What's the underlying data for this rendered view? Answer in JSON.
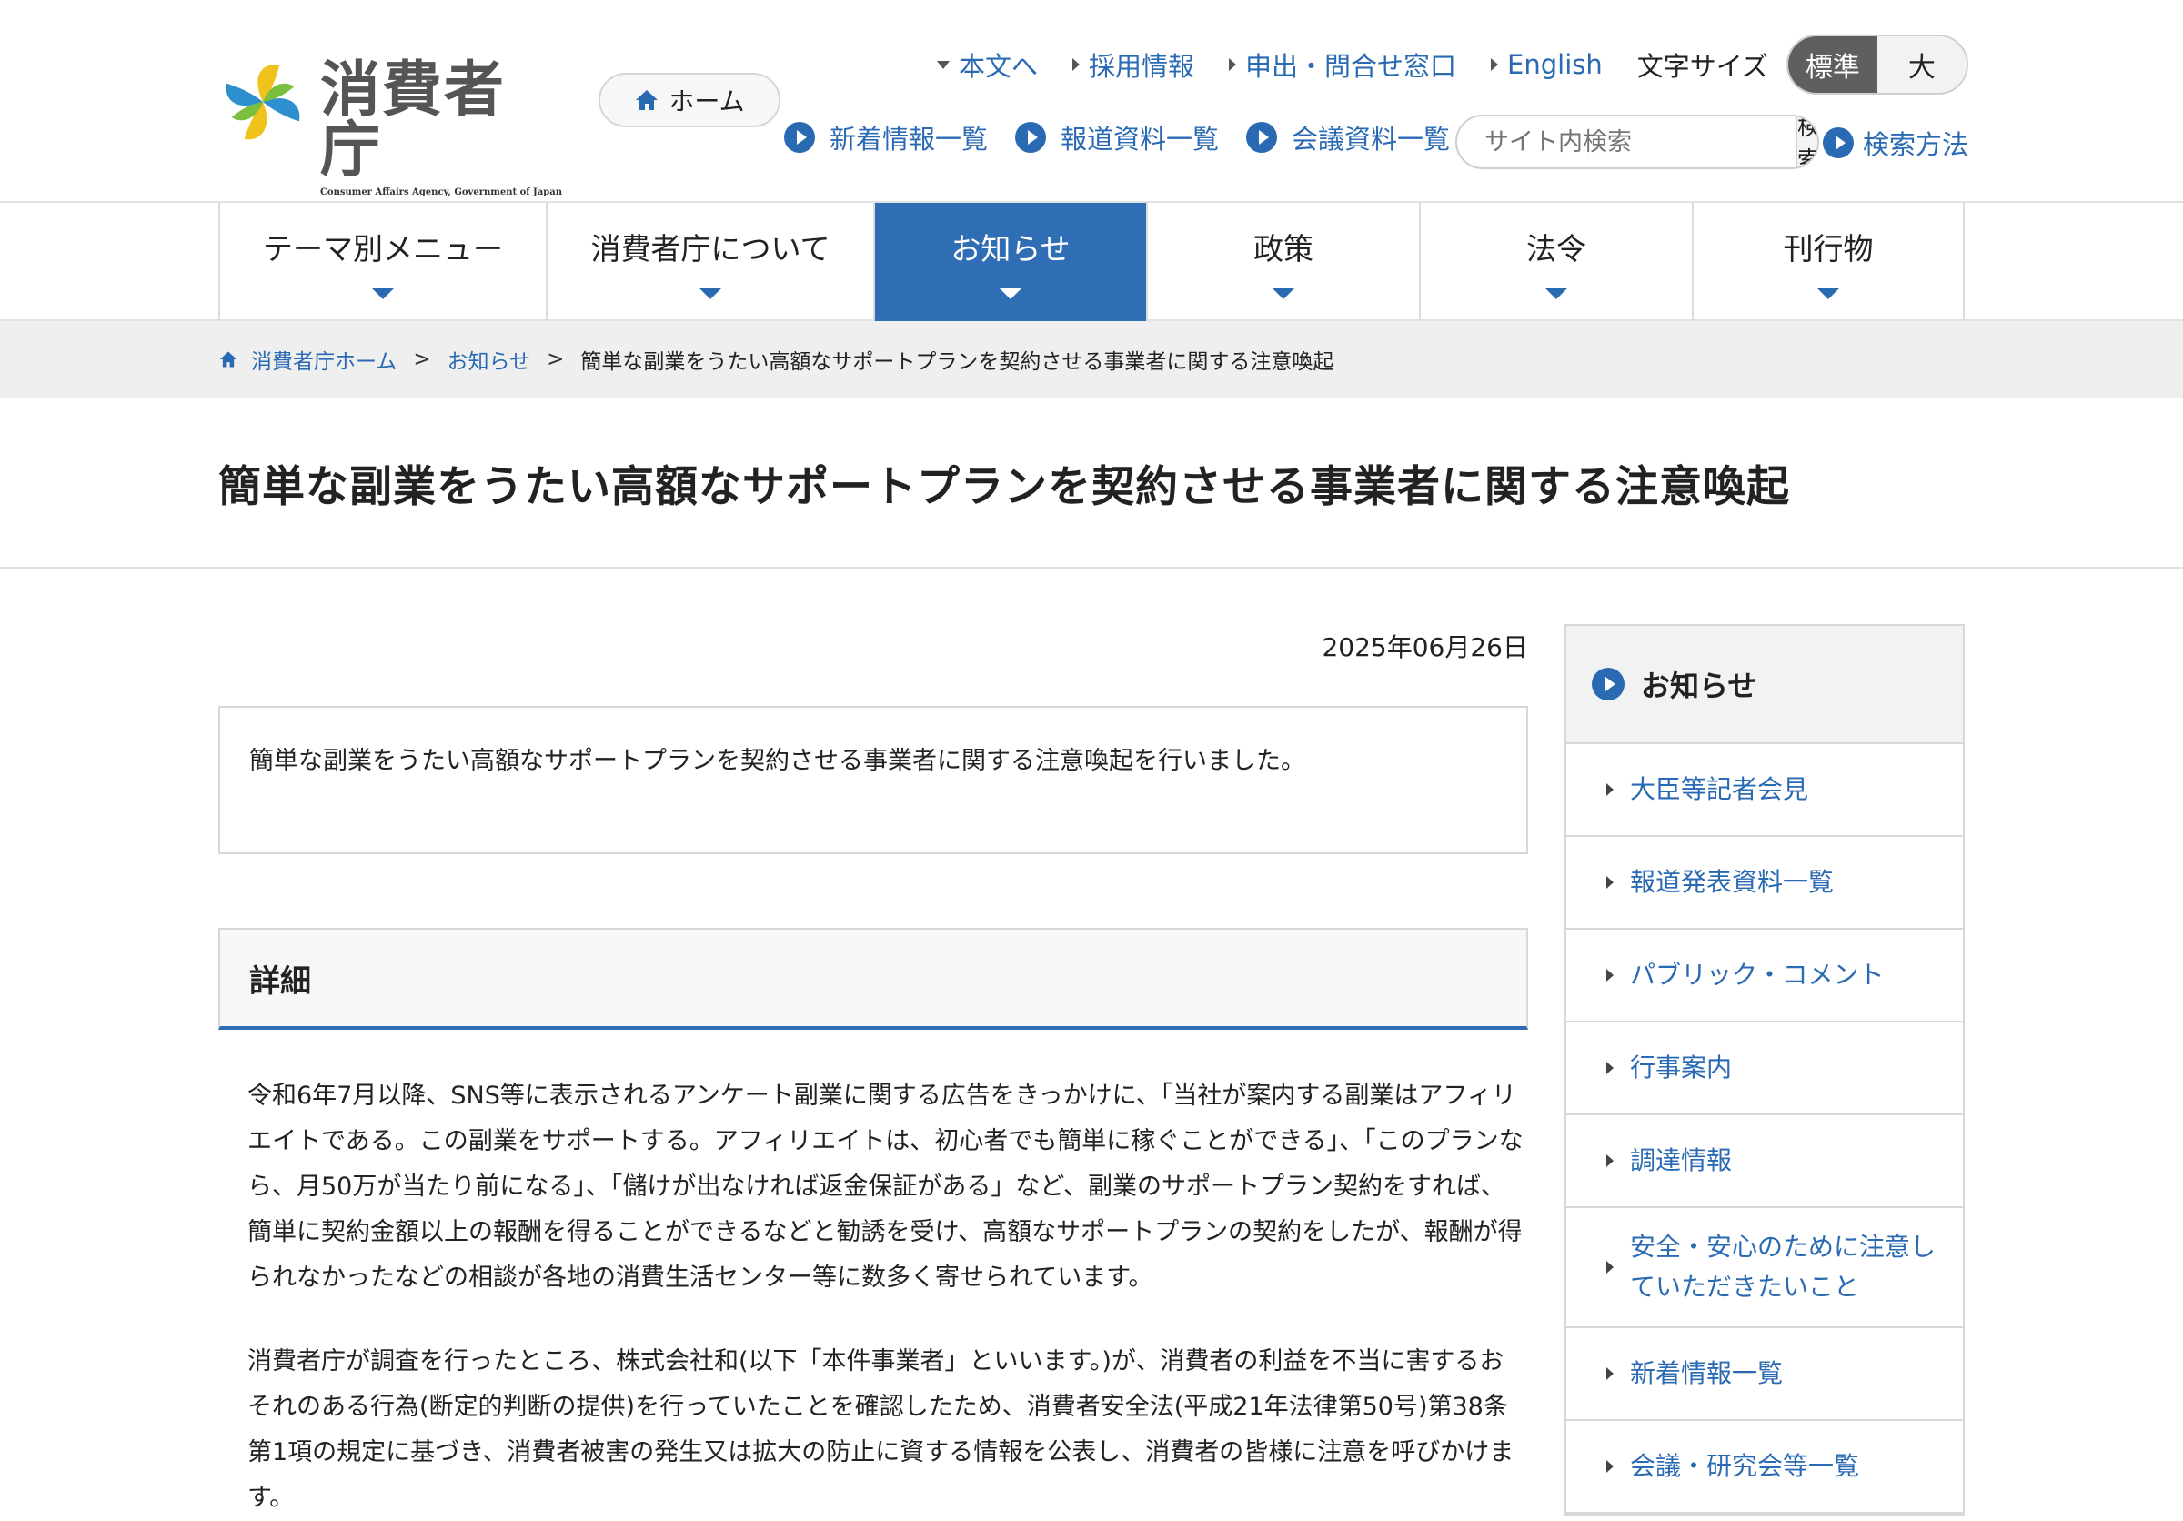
{
  "header": {
    "logo_text": "消費者庁",
    "logo_subtitle": "Consumer Affairs Agency, Government of Japan",
    "home_label": "ホーム",
    "util_links": [
      "本文へ",
      "採用情報",
      "申出・問合せ窓口",
      "English"
    ],
    "font_size_label": "文字サイズ",
    "font_size_options": [
      "標準",
      "大"
    ],
    "sub_links": [
      "新着情報一覧",
      "報道資料一覧",
      "会議資料一覧"
    ],
    "search_placeholder": "サイト内検索",
    "search_button": "検索",
    "search_help": "検索方法"
  },
  "nav": {
    "items": [
      "テーマ別メニュー",
      "消費者庁について",
      "お知らせ",
      "政策",
      "法令",
      "刊行物"
    ],
    "active": "お知らせ"
  },
  "breadcrumb": {
    "home": "消費者庁ホーム",
    "parent": "お知らせ",
    "current": "簡単な副業をうたい高額なサポートプランを契約させる事業者に関する注意喚起"
  },
  "page": {
    "title": "簡単な副業をうたい高額なサポートプランを契約させる事業者に関する注意喚起",
    "date": "2025年06月26日",
    "summary": "簡単な副業をうたい高額なサポートプランを契約させる事業者に関する注意喚起を行いました。",
    "section_title": "詳細",
    "para1": "令和6年7月以降、SNS等に表示されるアンケート副業に関する広告をきっかけに、「当社が案内する副業はアフィリエイトである。この副業をサポートする。アフィリエイトは、初心者でも簡単に稼ぐことができる」、「このプランなら、月50万が当たり前になる」、「儲けが出なければ返金保証がある」など、副業のサポートプラン契約をすれば、簡単に契約金額以上の報酬を得ることができるなどと勧誘を受け、高額なサポートプランの契約をしたが、報酬が得られなかったなどの相談が各地の消費生活センター等に数多く寄せられています。",
    "para2": "消費者庁が調査を行ったところ、株式会社和(以下「本件事業者」といいます。)が、消費者の利益を不当に害するおそれのある行為(断定的判断の提供)を行っていたことを確認したため、消費者安全法(平成21年法律第50号)第38条第1項の規定に基づき、消費者被害の発生又は拡大の防止に資する情報を公表し、消費者の皆様に注意を呼びかけます。"
  },
  "sidebar": {
    "title": "お知らせ",
    "items": [
      "大臣等記者会見",
      "報道発表資料一覧",
      "パブリック・コメント",
      "行事案内",
      "調達情報",
      "安全・安心のために注意していただきたいこと",
      "新着情報一覧",
      "会議・研究会等一覧"
    ]
  },
  "colors": {
    "accent": "#2f6db5",
    "link": "#2a6ab3"
  }
}
